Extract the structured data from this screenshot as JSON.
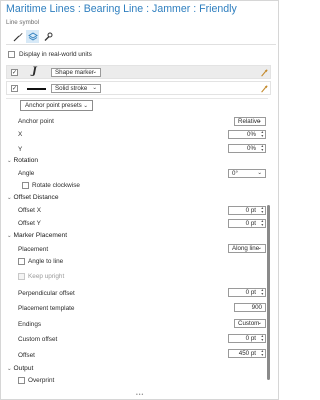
{
  "header": {
    "title": "Maritime Lines : Bearing Line : Jammer : Friendly",
    "subtitle": "Line symbol"
  },
  "tabs": [
    {
      "icon": "brush-icon",
      "active": false
    },
    {
      "icon": "layers-icon",
      "active": true
    },
    {
      "icon": "wrench-icon",
      "active": false
    }
  ],
  "display_real_world": {
    "label": "Display in real-world units",
    "checked": false
  },
  "layers": [
    {
      "checked": true,
      "preview": "J",
      "type": "Shape marker"
    },
    {
      "checked": true,
      "preview": "line",
      "type": "Solid stroke"
    }
  ],
  "anchor_presets_label": "Anchor point presets",
  "anchor": {
    "label": "Anchor point",
    "mode": "Relative",
    "x_label": "X",
    "x_value": "0%",
    "y_label": "Y",
    "y_value": "0%"
  },
  "rotation": {
    "header": "Rotation",
    "angle_label": "Angle",
    "angle_value": "0°",
    "clockwise_label": "Rotate clockwise",
    "clockwise_checked": false
  },
  "offset_distance": {
    "header": "Offset Distance",
    "x_label": "Offset X",
    "x_value": "0 pt",
    "y_label": "Offset Y",
    "y_value": "0 pt"
  },
  "marker_placement": {
    "header": "Marker Placement",
    "placement_label": "Placement",
    "placement_value": "Along line",
    "angle_to_line_label": "Angle to line",
    "angle_to_line_checked": false,
    "keep_upright_label": "Keep upright",
    "keep_upright_checked": false,
    "perp_offset_label": "Perpendicular offset",
    "perp_offset_value": "0 pt",
    "template_label": "Placement template",
    "template_value": "900",
    "endings_label": "Endings",
    "endings_value": "Custom",
    "custom_offset_label": "Custom offset",
    "custom_offset_value": "0 pt",
    "offset_label": "Offset",
    "offset_value": "450 pt"
  },
  "output": {
    "header": "Output",
    "overprint_label": "Overprint",
    "overprint_checked": false
  },
  "colors": {
    "title": "#2f7fbf",
    "active_tab": "#d7e9f7"
  }
}
